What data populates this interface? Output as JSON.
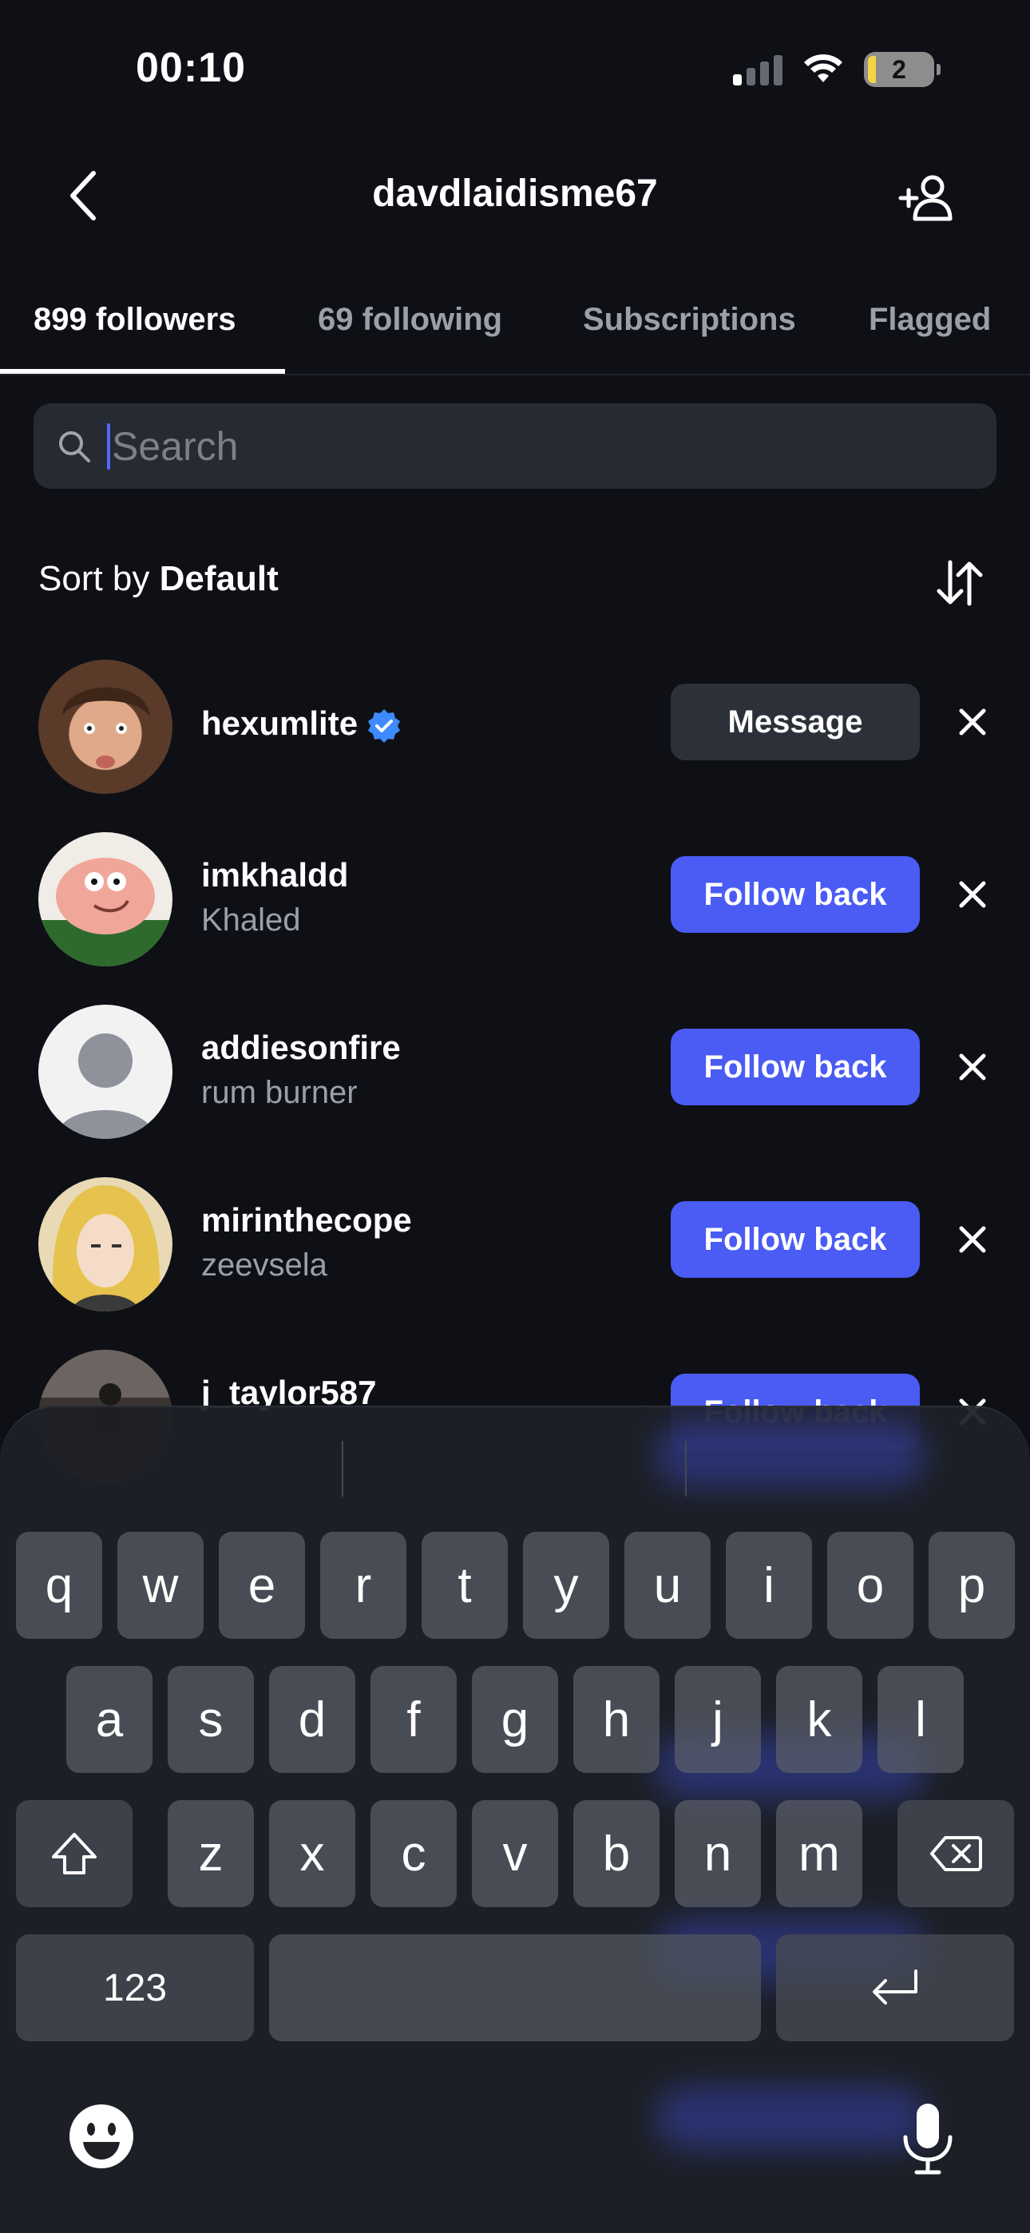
{
  "status_bar": {
    "time": "00:10",
    "battery": "2"
  },
  "header": {
    "title": "davdlaidisme67"
  },
  "tabs": [
    {
      "label": "899 followers",
      "active": true
    },
    {
      "label": "69 following",
      "active": false
    },
    {
      "label": "Subscriptions",
      "active": false
    },
    {
      "label": "Flagged",
      "active": false
    }
  ],
  "search": {
    "placeholder": "Search",
    "value": ""
  },
  "sort": {
    "prefix": "Sort by",
    "value": "Default"
  },
  "followers": [
    {
      "username": "hexumlite",
      "verified": true,
      "subtitle": "",
      "action": "Message"
    },
    {
      "username": "imkhaldd",
      "verified": false,
      "subtitle": "Khaled",
      "action": "Follow back"
    },
    {
      "username": "addiesonfire",
      "verified": false,
      "subtitle": "rum burner",
      "action": "Follow back"
    },
    {
      "username": "mirinthecope",
      "verified": false,
      "subtitle": "zeevsela",
      "action": "Follow back"
    },
    {
      "username": "j_taylor587",
      "verified": false,
      "subtitle": "",
      "action": "Follow back"
    }
  ],
  "keyboard": {
    "row1": [
      "q",
      "w",
      "e",
      "r",
      "t",
      "y",
      "u",
      "i",
      "o",
      "p"
    ],
    "row2": [
      "a",
      "s",
      "d",
      "f",
      "g",
      "h",
      "j",
      "k",
      "l"
    ],
    "row3": [
      "z",
      "x",
      "c",
      "v",
      "b",
      "n",
      "m"
    ],
    "numbers_label": "123"
  },
  "colors": {
    "accent": "#4a5cf4",
    "background": "#0e1016",
    "caret": "#4f6bff",
    "verified": "#3d8bff"
  }
}
